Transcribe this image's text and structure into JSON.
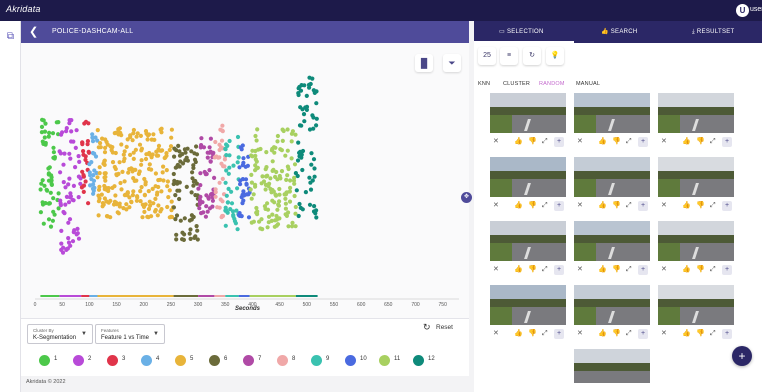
{
  "app": {
    "logo": "Akridata",
    "user_initial": "U",
    "user_name": "user1"
  },
  "dataset": {
    "title": "POLICE-DASHCAM-ALL"
  },
  "chart_data": {
    "type": "scatter",
    "xlabel": "Seconds",
    "ticks": [
      0,
      50,
      100,
      150,
      200,
      250,
      300,
      350,
      400,
      450,
      500,
      550,
      600,
      650,
      700,
      750
    ],
    "xlim": [
      0,
      780
    ],
    "clusters": [
      {
        "id": 1,
        "color": "#4cc84a",
        "range": [
          10,
          45
        ],
        "ymin": 0.25,
        "ymax": 0.72
      },
      {
        "id": 2,
        "color": "#b84ad8",
        "range": [
          45,
          85
        ],
        "ymin": 0.15,
        "ymax": 0.72
      },
      {
        "id": 3,
        "color": "#e0344a",
        "range": [
          85,
          100
        ],
        "ymin": 0.35,
        "ymax": 0.72
      },
      {
        "id": 4,
        "color": "#6ab0e6",
        "range": [
          100,
          115
        ],
        "ymin": 0.4,
        "ymax": 0.66
      },
      {
        "id": 5,
        "color": "#e8b43a",
        "range": [
          115,
          255
        ],
        "ymin": 0.3,
        "ymax": 0.68
      },
      {
        "id": 6,
        "color": "#6b6b3a",
        "range": [
          255,
          300
        ],
        "ymin": 0.2,
        "ymax": 0.62
      },
      {
        "id": 7,
        "color": "#b04aa6",
        "range": [
          300,
          330
        ],
        "ymin": 0.3,
        "ymax": 0.66
      },
      {
        "id": 8,
        "color": "#f0a8a8",
        "range": [
          330,
          350
        ],
        "ymin": 0.3,
        "ymax": 0.7
      },
      {
        "id": 9,
        "color": "#3ac2b0",
        "range": [
          350,
          375
        ],
        "ymin": 0.25,
        "ymax": 0.66
      },
      {
        "id": 10,
        "color": "#4a6ae0",
        "range": [
          375,
          395
        ],
        "ymin": 0.3,
        "ymax": 0.62
      },
      {
        "id": 11,
        "color": "#a8d060",
        "range": [
          395,
          480
        ],
        "ymin": 0.25,
        "ymax": 0.68
      },
      {
        "id": 12,
        "color": "#0e8a7a",
        "range": [
          480,
          520
        ],
        "ymin": 0.3,
        "ymax": 0.9
      }
    ]
  },
  "controls": {
    "cluster_by_label": "Cluster By",
    "cluster_by_value": "K-Segmentation",
    "features_label": "Features",
    "features_value": "Feature 1 vs Time",
    "reset": "Reset",
    "clusters": [
      "1",
      "2",
      "3",
      "4",
      "5",
      "6",
      "7",
      "8",
      "9",
      "10",
      "11",
      "12"
    ]
  },
  "footer": "Akridata © 2022",
  "right_tabs": [
    "SELECTION",
    "SEARCH",
    "RESULTSET"
  ],
  "tool_count": "25",
  "sub_tabs": [
    "KNN",
    "CLUSTER",
    "RANDOM",
    "MANUAL"
  ],
  "thumb_actions": {
    "close": "✕",
    "like": "👍",
    "dislike": "👎",
    "expand": "⤢",
    "add": "+"
  }
}
